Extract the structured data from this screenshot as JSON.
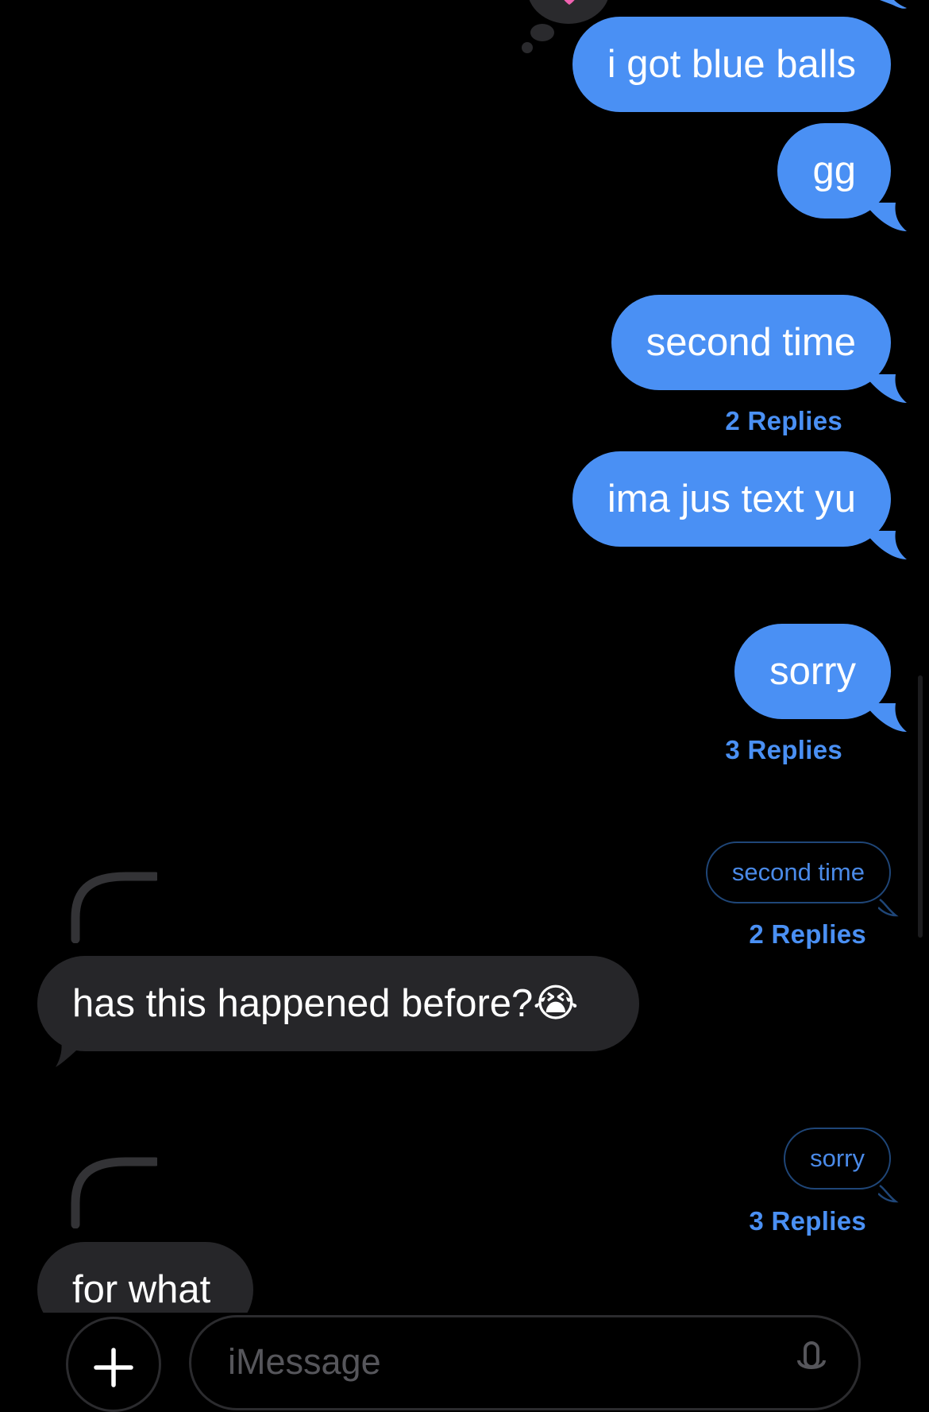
{
  "colors": {
    "outgoing_bubble": "#4a90f4",
    "incoming_bubble": "#262629",
    "background": "#000000",
    "reply_link": "#4a90f4"
  },
  "messages": {
    "out1": {
      "text": "i got blue balls"
    },
    "out2": {
      "text": "gg"
    },
    "out3": {
      "text": "second time",
      "replies": "2 Replies"
    },
    "out4": {
      "text": "ima jus text yu"
    },
    "out5": {
      "text": "sorry",
      "replies": "3 Replies"
    }
  },
  "threads": [
    {
      "quote": "second time",
      "replies": "2 Replies",
      "reply_text": "has this happened before?",
      "reply_emoji": "😭"
    },
    {
      "quote": "sorry",
      "replies": "3 Replies",
      "reply_text": "for what"
    }
  ],
  "tapback": {
    "icon": "heart-tapback-icon"
  },
  "input_bar": {
    "placeholder": "iMessage",
    "plus_icon": "plus-icon",
    "mic_icon": "microphone-icon"
  }
}
